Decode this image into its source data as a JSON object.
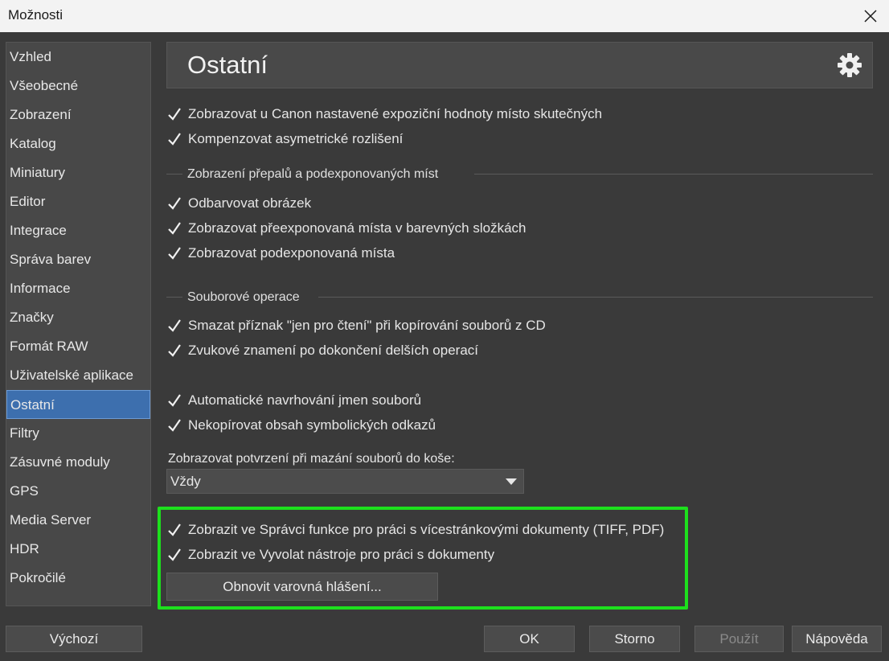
{
  "window": {
    "title": "Možnosti"
  },
  "sidebar": {
    "items": [
      {
        "label": "Vzhled"
      },
      {
        "label": "Všeobecné"
      },
      {
        "label": "Zobrazení"
      },
      {
        "label": "Katalog"
      },
      {
        "label": "Miniatury"
      },
      {
        "label": "Editor"
      },
      {
        "label": "Integrace"
      },
      {
        "label": "Správa barev"
      },
      {
        "label": "Informace"
      },
      {
        "label": "Značky"
      },
      {
        "label": "Formát RAW"
      },
      {
        "label": "Uživatelské aplikace"
      },
      {
        "label": "Ostatní",
        "active": true
      },
      {
        "label": "Filtry"
      },
      {
        "label": "Zásuvné moduly"
      },
      {
        "label": "GPS"
      },
      {
        "label": "Media Server"
      },
      {
        "label": "HDR"
      },
      {
        "label": "Pokročilé"
      }
    ]
  },
  "header": {
    "title": "Ostatní",
    "icon": "gear-icon"
  },
  "options": {
    "canon_exposure": {
      "label": "Zobrazovat u Canon nastavené expoziční hodnoty místo skutečných",
      "checked": true
    },
    "asymmetric": {
      "label": "Kompenzovat asymetrické rozlišení",
      "checked": true
    },
    "highlights_section": "Zobrazení přepalů a podexponovaných míst",
    "desaturate": {
      "label": "Odbarvovat obrázek",
      "checked": true
    },
    "overexposed": {
      "label": "Zobrazovat přeexponovaná místa v barevných složkách",
      "checked": true
    },
    "underexposed": {
      "label": "Zobrazovat podexponovaná místa",
      "checked": true
    },
    "file_section": "Souborové operace",
    "readonly_flag": {
      "label": "Smazat příznak \"jen pro čtení\" při kopírování souborů z CD",
      "checked": true
    },
    "sound": {
      "label": "Zvukové znamení po dokončení delších operací",
      "checked": true
    },
    "autoname": {
      "label": "Automatické navrhování jmen souborů",
      "checked": true
    },
    "symlinks": {
      "label": "Nekopírovat obsah symbolických odkazů",
      "checked": true
    },
    "trash_confirm_label": "Zobrazovat potvrzení při mazání souborů do koše:",
    "trash_confirm_value": "Vždy",
    "multipage": {
      "label": "Zobrazit ve Správci funkce pro práci s vícestránkovými dokumenty (TIFF, PDF)",
      "checked": true
    },
    "doc_tools": {
      "label": "Zobrazit ve Vyvolat nástroje pro práci s dokumenty",
      "checked": true
    },
    "reset_warnings": "Obnovit varovná hlášení..."
  },
  "footer": {
    "default": "Výchozí",
    "ok": "OK",
    "cancel": "Storno",
    "apply": "Použít",
    "help": "Nápověda"
  },
  "colors": {
    "accent": "#3d6fae",
    "highlight_border": "#1de01d",
    "background": "#3a3a3a"
  }
}
